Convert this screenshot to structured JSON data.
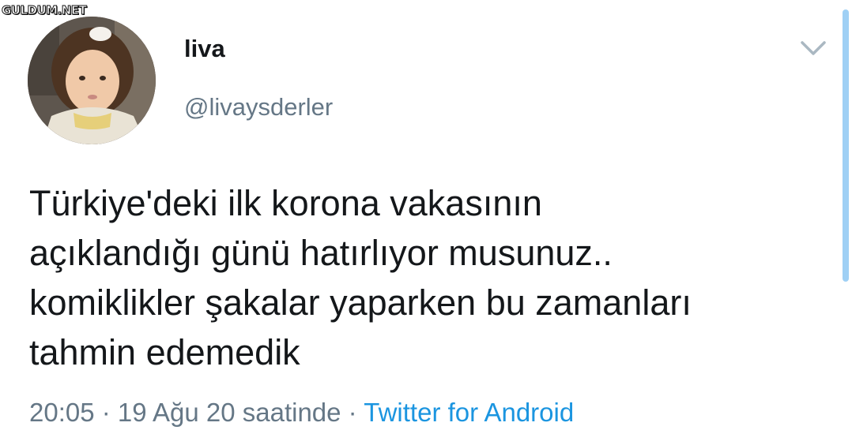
{
  "watermark": "GULDUM.NET",
  "tweet": {
    "display_name": "liva",
    "handle": "@livaysderler",
    "text": "Türkiye'deki ilk korona vakasının\naçıklandığı günü hatırlıyor musunuz..\nkomiklikler şakalar yaparken bu zamanları\ntahmin edemedik",
    "time": "20:05",
    "separator": " · ",
    "date": "19 Ağu 20 saatinde",
    "source": "Twitter for Android"
  },
  "icons": {
    "more_menu": "chevron-down-icon"
  },
  "colors": {
    "text": "#14171a",
    "muted": "#657786",
    "link": "#1b95e0",
    "scrollbar": "#9fd0f5"
  }
}
